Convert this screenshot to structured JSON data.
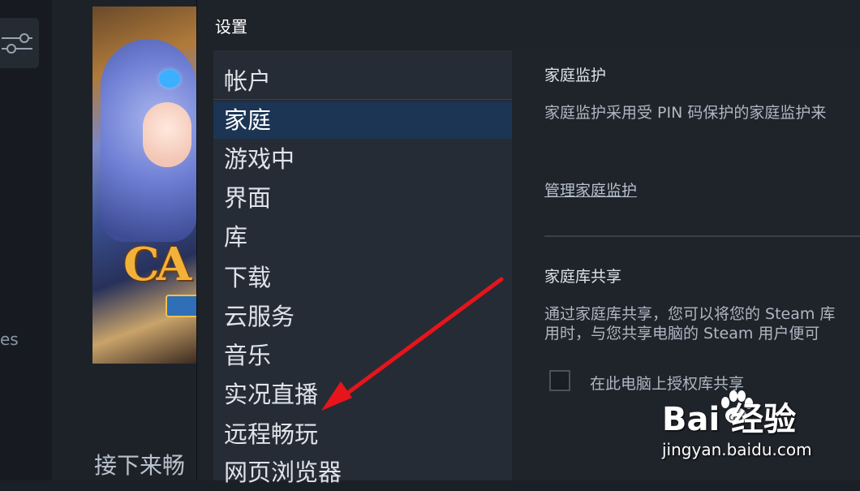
{
  "background": {
    "left_fragment": "es",
    "bottom_text": "接下来畅",
    "cover_logo": "CA"
  },
  "settings": {
    "title": "设置",
    "nav_items": [
      {
        "label": "帐户",
        "active": false
      },
      {
        "label": "家庭",
        "active": true
      },
      {
        "label": "游戏中",
        "active": false
      },
      {
        "label": "界面",
        "active": false
      },
      {
        "label": "库",
        "active": false
      },
      {
        "label": "下载",
        "active": false
      },
      {
        "label": "云服务",
        "active": false
      },
      {
        "label": "音乐",
        "active": false
      },
      {
        "label": "实况直播",
        "active": false
      },
      {
        "label": "远程畅玩",
        "active": false
      },
      {
        "label": "网页浏览器",
        "active": false
      }
    ],
    "family_view": {
      "title": "家庭监护",
      "description": "家庭监护采用受 PIN 码保护的家庭监护来",
      "manage_link": "管理家庭监护"
    },
    "library_sharing": {
      "title": "家庭库共享",
      "description_line1": "通过家庭库共享，您可以将您的 Steam 库",
      "description_line2": "用时，与您共享电脑的 Steam 用户便可",
      "checkbox_label": "在此电脑上授权库共享",
      "checkbox_checked": false
    }
  },
  "watermark": {
    "logo_text": "Bai  经验",
    "url": "jingyan.baidu.com"
  },
  "colors": {
    "active_nav": "#1c3554",
    "arrow": "#e8141b"
  }
}
